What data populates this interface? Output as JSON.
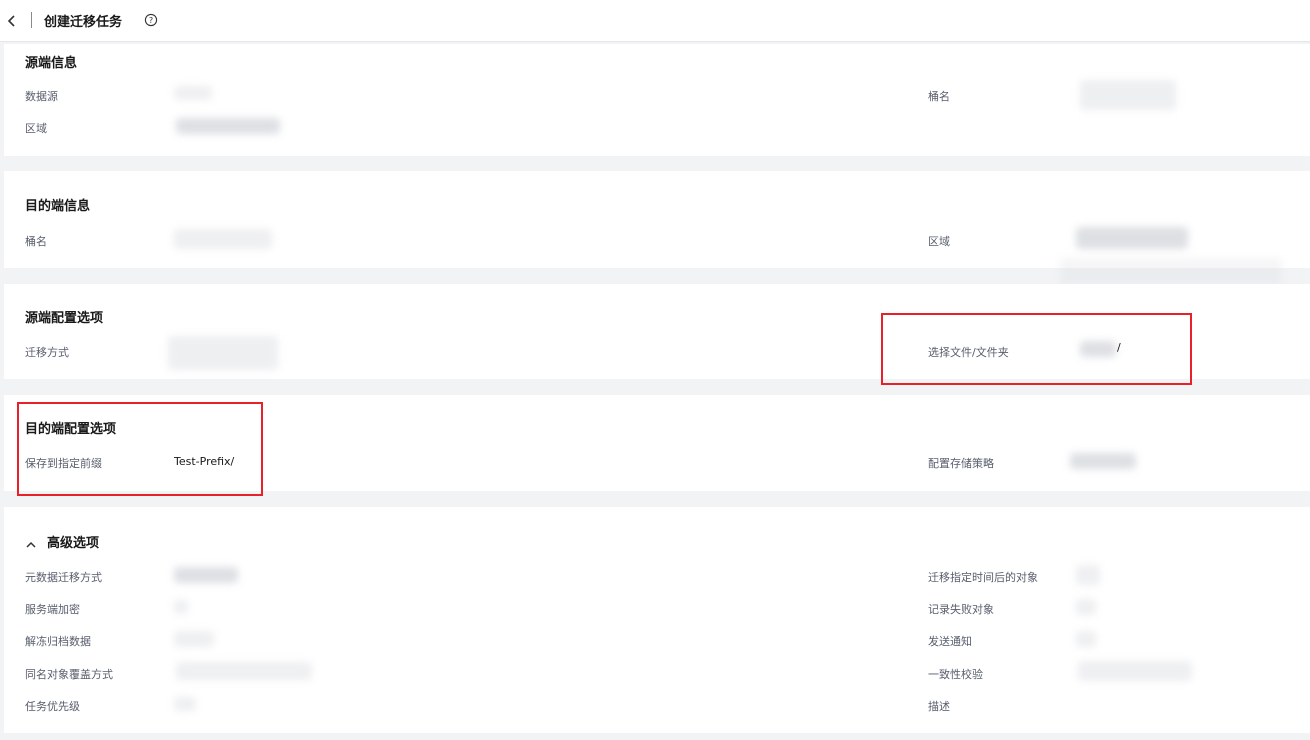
{
  "header": {
    "title": "创建迁移任务"
  },
  "source_info": {
    "title": "源端信息",
    "data_source_label": "数据源",
    "region_label": "区域",
    "bucket_label": "桶名"
  },
  "dest_info": {
    "title": "目的端信息",
    "bucket_label": "桶名",
    "region_label": "区域"
  },
  "source_config": {
    "title": "源端配置选项",
    "migration_method_label": "迁移方式",
    "select_file_label": "选择文件/文件夹",
    "select_file_suffix": "/"
  },
  "dest_config": {
    "title": "目的端配置选项",
    "prefix_label": "保存到指定前缀",
    "prefix_value": "Test-Prefix/",
    "storage_policy_label": "配置存储策略"
  },
  "advanced": {
    "title": "高级选项",
    "left": [
      "元数据迁移方式",
      "服务端加密",
      "解冻归档数据",
      "同名对象覆盖方式",
      "任务优先级"
    ],
    "right": [
      "迁移指定时间后的对象",
      "记录失败对象",
      "发送通知",
      "一致性校验",
      "描述"
    ]
  },
  "colors": {
    "highlight": "#e8202a",
    "page_bg": "#f2f3f5",
    "card_bg": "#ffffff"
  },
  "icons": {
    "back": "chevron-left-icon",
    "help": "question-circle-icon",
    "collapse": "chevron-up-icon"
  }
}
